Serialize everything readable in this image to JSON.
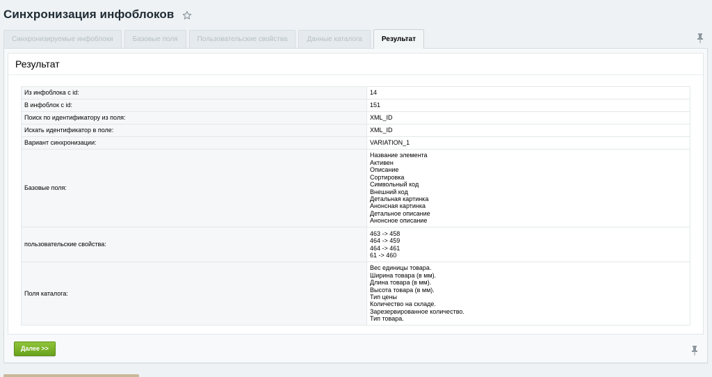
{
  "header": {
    "title": "Синхронизация инфоблоков",
    "favorite_icon": "star-outline-icon"
  },
  "tabs": [
    {
      "label": "Синхронизируемые инфоблоки",
      "active": false
    },
    {
      "label": "Базовые поля",
      "active": false
    },
    {
      "label": "Пользовательские свойства",
      "active": false
    },
    {
      "label": "Данные каталога",
      "active": false
    },
    {
      "label": "Результат",
      "active": true
    }
  ],
  "pin_icon": "pin-icon",
  "section": {
    "title": "Результат"
  },
  "result_rows": [
    {
      "label": "Из инфоблока с id:",
      "values": [
        "14"
      ]
    },
    {
      "label": "В инфоблок с id:",
      "values": [
        "151"
      ]
    },
    {
      "label": "Поиск по идентификатору из поля:",
      "values": [
        "XML_ID"
      ]
    },
    {
      "label": "Искать идентификатор в поле:",
      "values": [
        "XML_ID"
      ]
    },
    {
      "label": "Вариант синхронизации:",
      "values": [
        "VARIATION_1"
      ]
    },
    {
      "label": "Базовые поля:",
      "values": [
        "Название элемента",
        "Активен",
        "Описание",
        "Сортировка",
        "Символьный код",
        "Внешний код",
        "Детальная картинка",
        "Анонсная картинка",
        "Детальное описание",
        "Анонсное описание"
      ]
    },
    {
      "label": "пользовательские свойства:",
      "values": [
        "463 -> 458",
        "464 -> 459",
        "464 -> 461",
        "61 -> 460"
      ]
    },
    {
      "label": "Поля каталога:",
      "values": [
        "Вес единицы товара.",
        "Ширина товара (в мм).",
        "Длина товара (в мм).",
        "Высота товара (в мм).",
        "Тип цены",
        "Количество на складе.",
        "Зарезервированное количество.",
        "Тип товара."
      ]
    }
  ],
  "footer": {
    "next_button_label": "Далее >>"
  },
  "colors": {
    "accent_green": "#7ab32a",
    "background": "#eef2f4"
  }
}
